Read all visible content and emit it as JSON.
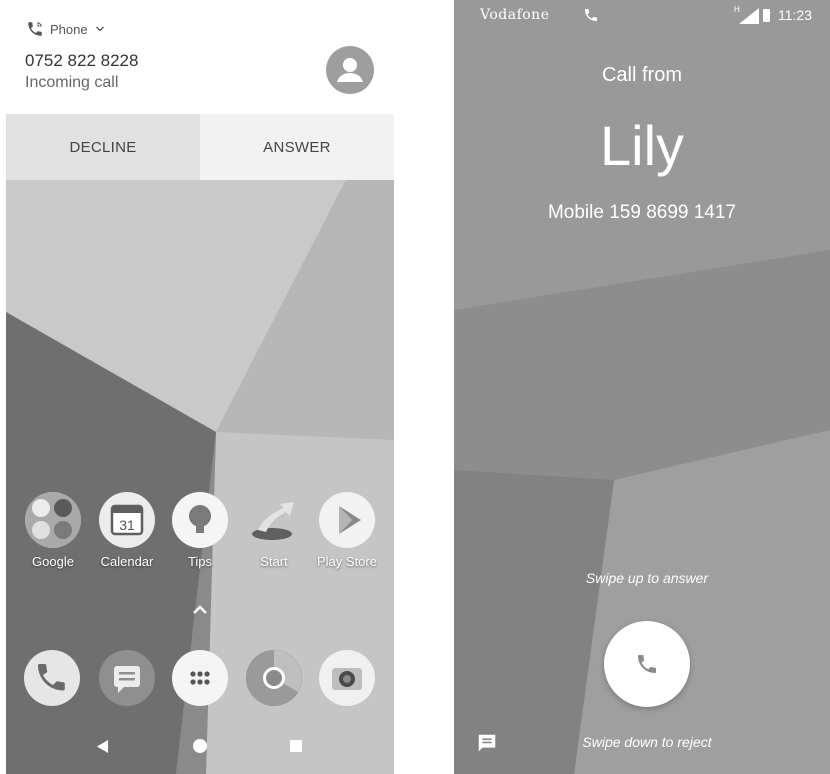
{
  "left_screen": {
    "notification": {
      "app_name": "Phone",
      "caller_number": "0752 822 8228",
      "status": "Incoming call",
      "decline_label": "DECLINE",
      "answer_label": "ANSWER",
      "icons": {
        "app": "phone-ringing-icon",
        "expand": "chevron-down-icon",
        "avatar": "person-avatar-icon"
      }
    },
    "home_apps": [
      {
        "label": "Google",
        "icon": "google-folder-icon"
      },
      {
        "label": "Calendar",
        "icon": "calendar-icon",
        "badge": "31"
      },
      {
        "label": "Tips",
        "icon": "lightbulb-icon"
      },
      {
        "label": "Start",
        "icon": "start-arrow-icon"
      },
      {
        "label": "Play Store",
        "icon": "play-store-icon"
      }
    ],
    "app_drawer_handle": "chevron-up-icon",
    "dock": [
      "phone-icon",
      "messages-icon",
      "app-drawer-icon",
      "chrome-icon",
      "camera-icon"
    ],
    "nav_bar": [
      "back-icon",
      "home-icon",
      "recents-icon"
    ]
  },
  "right_screen": {
    "status_bar": {
      "carrier": "Vodafone",
      "network_label": "H",
      "time": "11:23",
      "icons": [
        "call-active-icon",
        "signal-icon",
        "battery-icon"
      ]
    },
    "call_header": "Call from",
    "caller_name": "Lily",
    "caller_detail": "Mobile 159 8699 1417",
    "swipe_up_hint": "Swipe up to answer",
    "swipe_down_hint": "Swipe down to reject",
    "icons": {
      "answer": "phone-icon",
      "message": "message-icon"
    }
  },
  "colors": {
    "wallpaper_light": "#cfcfcf",
    "wallpaper_dark": "#7a7a7a",
    "notification_bg": "#ffffff",
    "decline_bg": "#e1e1e1",
    "answer_bg": "#f2f2f2"
  }
}
